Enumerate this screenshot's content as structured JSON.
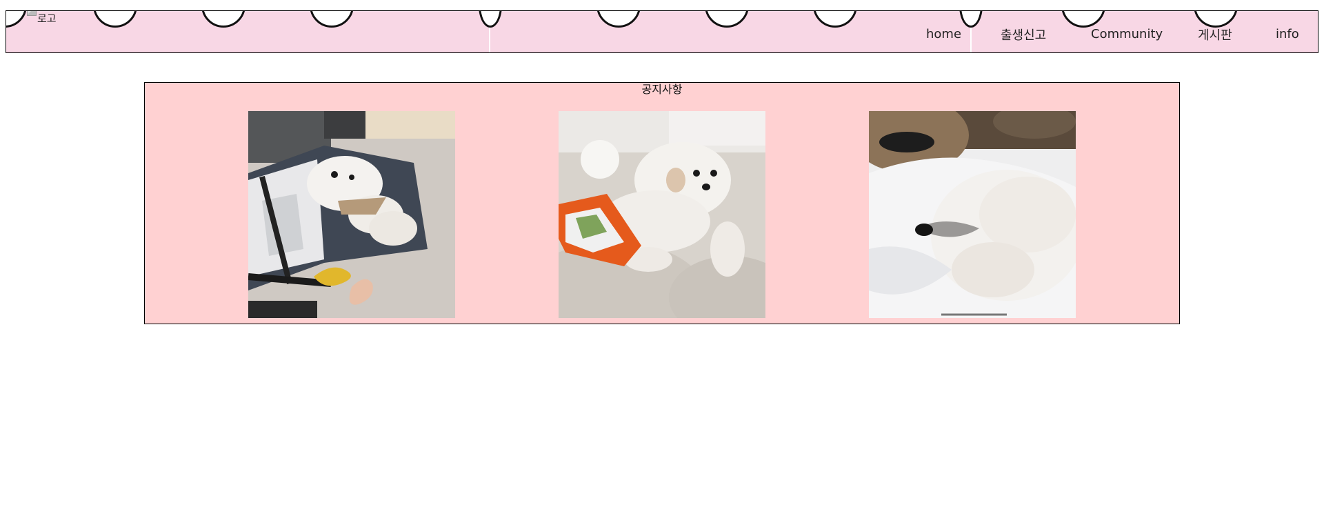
{
  "header": {
    "logo_alt": "로고",
    "nav": [
      {
        "label": "home"
      },
      {
        "label": "출생신고"
      },
      {
        "label": "Community"
      },
      {
        "label": "게시판"
      },
      {
        "label": "info"
      }
    ]
  },
  "notice": {
    "title": "공지사항",
    "photos": [
      {
        "description_icon": "dog-in-suitcase-photo"
      },
      {
        "description_icon": "dog-on-sofa-photo"
      },
      {
        "description_icon": "dog-closeup-photo"
      }
    ]
  },
  "colors": {
    "header_bg": "#f8d7e5",
    "notice_bg": "#ffd1d2"
  }
}
